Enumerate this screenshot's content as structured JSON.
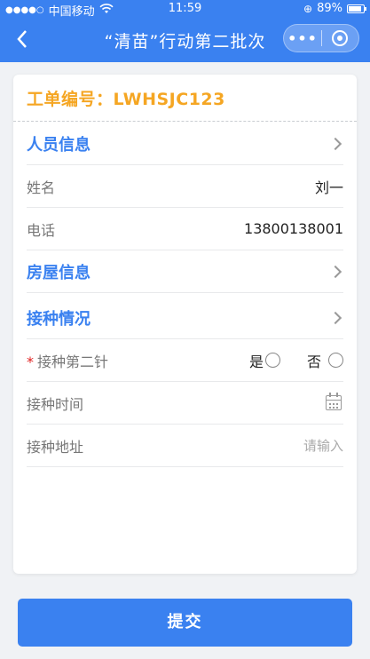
{
  "status_bar": {
    "carrier": "中国移动",
    "time": "11:59",
    "battery": "89%"
  },
  "nav": {
    "title": "“清苗”行动第二批次",
    "back_icon": "chevron-left-icon",
    "more_icon": "more-dots-icon",
    "close_icon": "target-close-icon"
  },
  "card": {
    "order_label": "工单编号：LWHSJC123",
    "person_section": "人员信息",
    "name_label": "姓名",
    "name_value": "刘一",
    "phone_label": "电话",
    "phone_value": "13800138001",
    "house_section": "房屋信息",
    "vaccine_section": "接种情况",
    "second_dose_label": "接种第二针",
    "required_mark": "*",
    "option_yes": "是",
    "option_no": "否",
    "time_label": "接种时间",
    "address_label": "接种地址",
    "address_placeholder": "请输入"
  },
  "submit_label": "提交",
  "colors": {
    "primary": "#3a81f0",
    "order_accent": "#f5a623",
    "required": "#e02020"
  }
}
